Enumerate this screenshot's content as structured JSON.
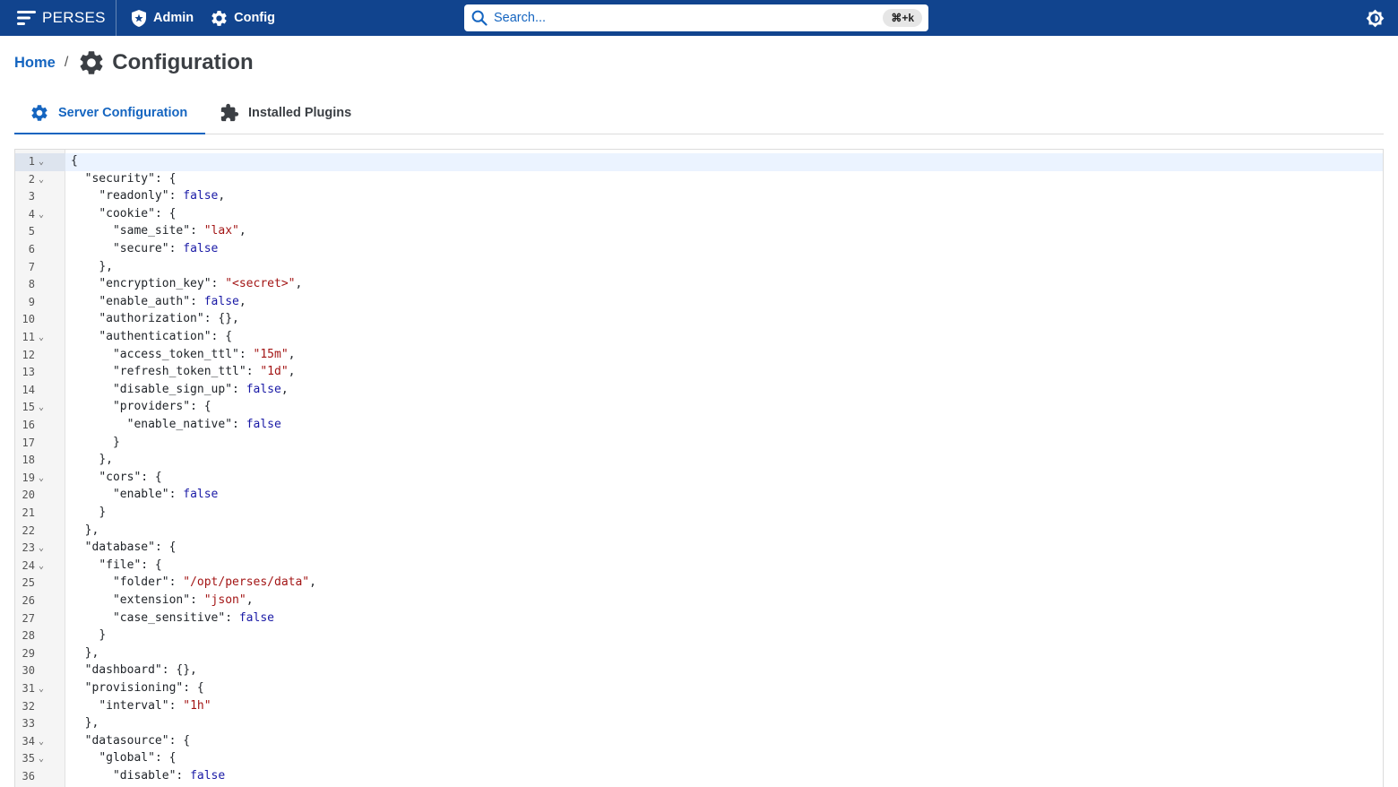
{
  "topbar": {
    "brand": "PERSES",
    "admin_label": "Admin",
    "config_label": "Config",
    "search_placeholder": "Search...",
    "search_shortcut": "⌘+k",
    "accent": "#11448e"
  },
  "breadcrumb": {
    "home": "Home",
    "separator": "/",
    "title": "Configuration"
  },
  "tabs": [
    {
      "label": "Server Configuration",
      "icon": "gear-icon",
      "active": true
    },
    {
      "label": "Installed Plugins",
      "icon": "puzzle-icon",
      "active": false
    }
  ],
  "editor": {
    "lines": [
      {
        "n": "1",
        "fold": true,
        "indent": 0,
        "tokens": [
          [
            "p",
            "{"
          ]
        ]
      },
      {
        "n": "2",
        "fold": true,
        "indent": 1,
        "tokens": [
          [
            "k",
            "\"security\""
          ],
          [
            "p",
            ": {"
          ]
        ]
      },
      {
        "n": "3",
        "fold": false,
        "indent": 2,
        "tokens": [
          [
            "k",
            "\"readonly\""
          ],
          [
            "p",
            ": "
          ],
          [
            "b",
            "false"
          ],
          [
            "p",
            ","
          ]
        ]
      },
      {
        "n": "4",
        "fold": true,
        "indent": 2,
        "tokens": [
          [
            "k",
            "\"cookie\""
          ],
          [
            "p",
            ": {"
          ]
        ]
      },
      {
        "n": "5",
        "fold": false,
        "indent": 3,
        "tokens": [
          [
            "k",
            "\"same_site\""
          ],
          [
            "p",
            ": "
          ],
          [
            "s",
            "\"lax\""
          ],
          [
            "p",
            ","
          ]
        ]
      },
      {
        "n": "6",
        "fold": false,
        "indent": 3,
        "tokens": [
          [
            "k",
            "\"secure\""
          ],
          [
            "p",
            ": "
          ],
          [
            "b",
            "false"
          ]
        ]
      },
      {
        "n": "7",
        "fold": false,
        "indent": 2,
        "tokens": [
          [
            "p",
            "},"
          ]
        ]
      },
      {
        "n": "8",
        "fold": false,
        "indent": 2,
        "tokens": [
          [
            "k",
            "\"encryption_key\""
          ],
          [
            "p",
            ": "
          ],
          [
            "s",
            "\"<secret>\""
          ],
          [
            "p",
            ","
          ]
        ]
      },
      {
        "n": "9",
        "fold": false,
        "indent": 2,
        "tokens": [
          [
            "k",
            "\"enable_auth\""
          ],
          [
            "p",
            ": "
          ],
          [
            "b",
            "false"
          ],
          [
            "p",
            ","
          ]
        ]
      },
      {
        "n": "10",
        "fold": false,
        "indent": 2,
        "tokens": [
          [
            "k",
            "\"authorization\""
          ],
          [
            "p",
            ": {},"
          ]
        ]
      },
      {
        "n": "11",
        "fold": true,
        "indent": 2,
        "tokens": [
          [
            "k",
            "\"authentication\""
          ],
          [
            "p",
            ": {"
          ]
        ]
      },
      {
        "n": "12",
        "fold": false,
        "indent": 3,
        "tokens": [
          [
            "k",
            "\"access_token_ttl\""
          ],
          [
            "p",
            ": "
          ],
          [
            "s",
            "\"15m\""
          ],
          [
            "p",
            ","
          ]
        ]
      },
      {
        "n": "13",
        "fold": false,
        "indent": 3,
        "tokens": [
          [
            "k",
            "\"refresh_token_ttl\""
          ],
          [
            "p",
            ": "
          ],
          [
            "s",
            "\"1d\""
          ],
          [
            "p",
            ","
          ]
        ]
      },
      {
        "n": "14",
        "fold": false,
        "indent": 3,
        "tokens": [
          [
            "k",
            "\"disable_sign_up\""
          ],
          [
            "p",
            ": "
          ],
          [
            "b",
            "false"
          ],
          [
            "p",
            ","
          ]
        ]
      },
      {
        "n": "15",
        "fold": true,
        "indent": 3,
        "tokens": [
          [
            "k",
            "\"providers\""
          ],
          [
            "p",
            ": {"
          ]
        ]
      },
      {
        "n": "16",
        "fold": false,
        "indent": 4,
        "tokens": [
          [
            "k",
            "\"enable_native\""
          ],
          [
            "p",
            ": "
          ],
          [
            "b",
            "false"
          ]
        ]
      },
      {
        "n": "17",
        "fold": false,
        "indent": 3,
        "tokens": [
          [
            "p",
            "}"
          ]
        ]
      },
      {
        "n": "18",
        "fold": false,
        "indent": 2,
        "tokens": [
          [
            "p",
            "},"
          ]
        ]
      },
      {
        "n": "19",
        "fold": true,
        "indent": 2,
        "tokens": [
          [
            "k",
            "\"cors\""
          ],
          [
            "p",
            ": {"
          ]
        ]
      },
      {
        "n": "20",
        "fold": false,
        "indent": 3,
        "tokens": [
          [
            "k",
            "\"enable\""
          ],
          [
            "p",
            ": "
          ],
          [
            "b",
            "false"
          ]
        ]
      },
      {
        "n": "21",
        "fold": false,
        "indent": 2,
        "tokens": [
          [
            "p",
            "}"
          ]
        ]
      },
      {
        "n": "22",
        "fold": false,
        "indent": 1,
        "tokens": [
          [
            "p",
            "},"
          ]
        ]
      },
      {
        "n": "23",
        "fold": true,
        "indent": 1,
        "tokens": [
          [
            "k",
            "\"database\""
          ],
          [
            "p",
            ": {"
          ]
        ]
      },
      {
        "n": "24",
        "fold": true,
        "indent": 2,
        "tokens": [
          [
            "k",
            "\"file\""
          ],
          [
            "p",
            ": {"
          ]
        ]
      },
      {
        "n": "25",
        "fold": false,
        "indent": 3,
        "tokens": [
          [
            "k",
            "\"folder\""
          ],
          [
            "p",
            ": "
          ],
          [
            "s",
            "\"/opt/perses/data\""
          ],
          [
            "p",
            ","
          ]
        ]
      },
      {
        "n": "26",
        "fold": false,
        "indent": 3,
        "tokens": [
          [
            "k",
            "\"extension\""
          ],
          [
            "p",
            ": "
          ],
          [
            "s",
            "\"json\""
          ],
          [
            "p",
            ","
          ]
        ]
      },
      {
        "n": "27",
        "fold": false,
        "indent": 3,
        "tokens": [
          [
            "k",
            "\"case_sensitive\""
          ],
          [
            "p",
            ": "
          ],
          [
            "b",
            "false"
          ]
        ]
      },
      {
        "n": "28",
        "fold": false,
        "indent": 2,
        "tokens": [
          [
            "p",
            "}"
          ]
        ]
      },
      {
        "n": "29",
        "fold": false,
        "indent": 1,
        "tokens": [
          [
            "p",
            "},"
          ]
        ]
      },
      {
        "n": "30",
        "fold": false,
        "indent": 1,
        "tokens": [
          [
            "k",
            "\"dashboard\""
          ],
          [
            "p",
            ": {},"
          ]
        ]
      },
      {
        "n": "31",
        "fold": true,
        "indent": 1,
        "tokens": [
          [
            "k",
            "\"provisioning\""
          ],
          [
            "p",
            ": {"
          ]
        ]
      },
      {
        "n": "32",
        "fold": false,
        "indent": 2,
        "tokens": [
          [
            "k",
            "\"interval\""
          ],
          [
            "p",
            ": "
          ],
          [
            "s",
            "\"1h\""
          ]
        ]
      },
      {
        "n": "33",
        "fold": false,
        "indent": 1,
        "tokens": [
          [
            "p",
            "},"
          ]
        ]
      },
      {
        "n": "34",
        "fold": true,
        "indent": 1,
        "tokens": [
          [
            "k",
            "\"datasource\""
          ],
          [
            "p",
            ": {"
          ]
        ]
      },
      {
        "n": "35",
        "fold": true,
        "indent": 2,
        "tokens": [
          [
            "k",
            "\"global\""
          ],
          [
            "p",
            ": {"
          ]
        ]
      },
      {
        "n": "36",
        "fold": false,
        "indent": 3,
        "tokens": [
          [
            "k",
            "\"disable\""
          ],
          [
            "p",
            ": "
          ],
          [
            "b",
            "false"
          ]
        ]
      }
    ]
  }
}
